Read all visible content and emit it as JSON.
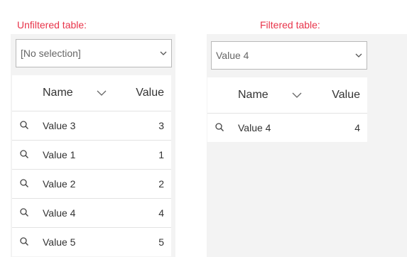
{
  "unfiltered": {
    "caption": "Unfiltered table:",
    "select_value": "[No selection]",
    "columns": {
      "name": "Name",
      "value": "Value"
    },
    "rows": [
      {
        "name": "Value 3",
        "value": "3"
      },
      {
        "name": "Value 1",
        "value": "1"
      },
      {
        "name": "Value 2",
        "value": "2"
      },
      {
        "name": "Value 4",
        "value": "4"
      },
      {
        "name": "Value 5",
        "value": "5"
      }
    ]
  },
  "filtered": {
    "caption": "Filtered table:",
    "select_value": "Value 4",
    "columns": {
      "name": "Name",
      "value": "Value"
    },
    "rows": [
      {
        "name": "Value 4",
        "value": "4"
      }
    ]
  },
  "colors": {
    "caption": "#e8344a",
    "panel_background": "#f3f3f3",
    "border": "#b9b9b9"
  },
  "icons": {
    "select_dropdown": "chevron-down-icon",
    "sort": "chevron-down-icon",
    "row_action": "search-icon"
  }
}
